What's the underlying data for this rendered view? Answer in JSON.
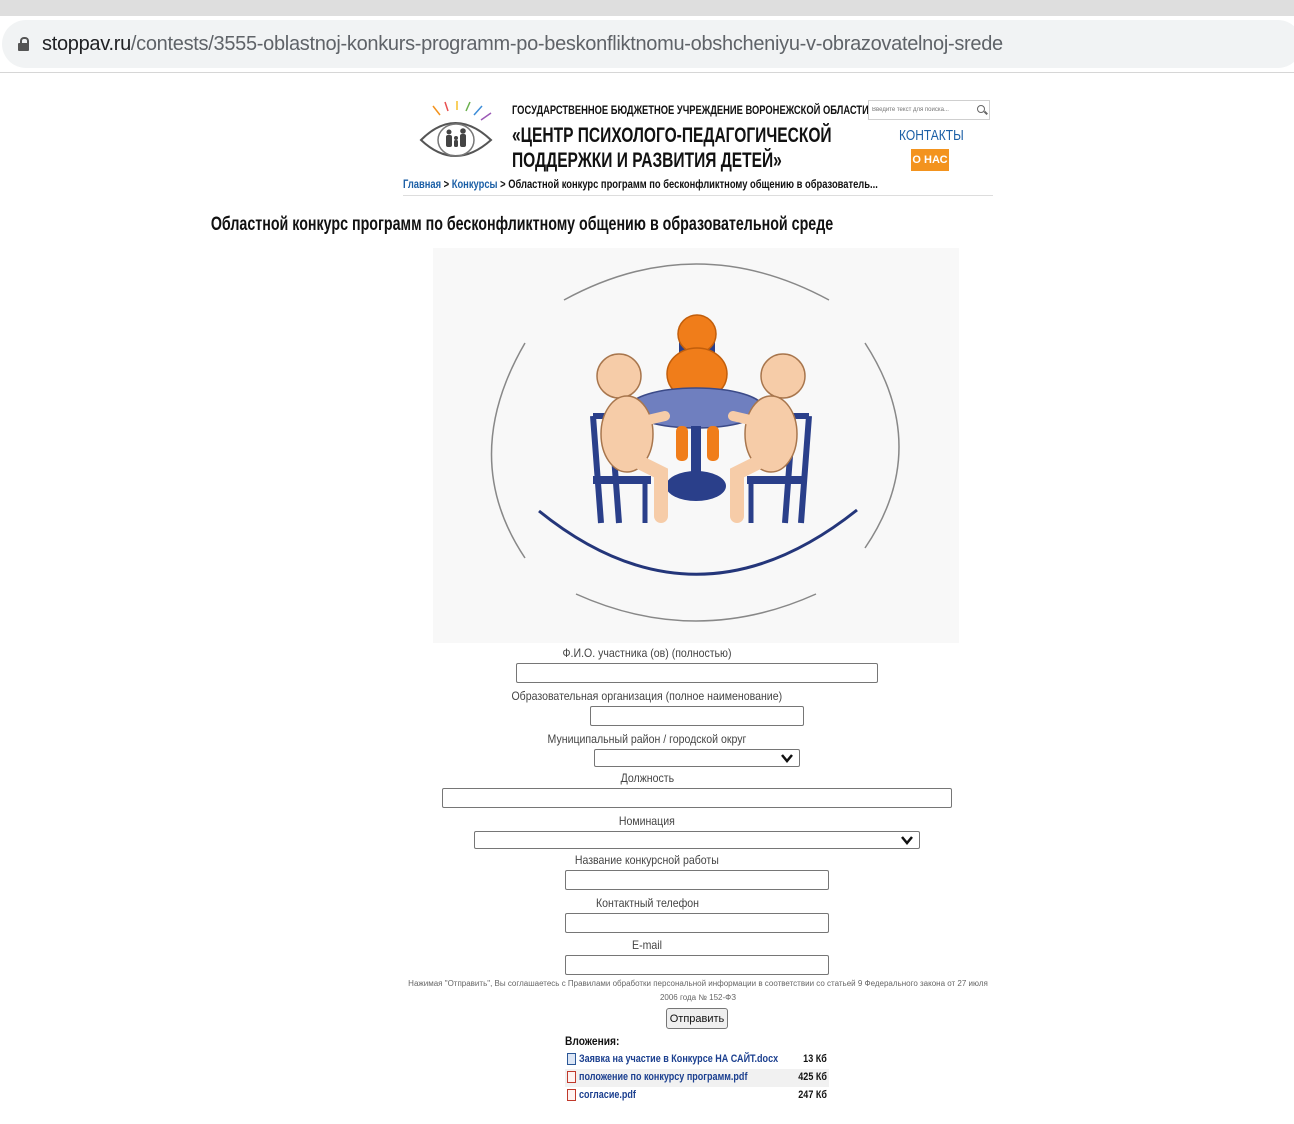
{
  "browser": {
    "url_host": "stoppav.ru",
    "url_path": "/contests/3555-oblastnoj-konkurs-programm-po-beskonfliktnomu-obshcheniyu-v-obrazovatelnoj-srede"
  },
  "header": {
    "org_line1": "ГОСУДАРСТВЕННОЕ БЮДЖЕТНОЕ УЧРЕЖДЕНИЕ ВОРОНЕЖСКОЙ ОБЛАСТИ",
    "org_line2": "«ЦЕНТР ПСИХОЛОГО-ПЕДАГОГИЧЕСКОЙ",
    "org_line3": "ПОДДЕРЖКИ И РАЗВИТИЯ ДЕТЕЙ»",
    "search_placeholder": "Введите текст для поиска...",
    "contacts_label": "КОНТАКТЫ",
    "about_label": "О НАС"
  },
  "breadcrumb": {
    "home": "Главная",
    "sep1": " > ",
    "contests": "Конкурсы",
    "sep2": " > ",
    "current": "Областной конкурс программ по бесконфликтному общению в образователь..."
  },
  "page": {
    "title": "Областной конкурс программ по бесконфликтному общению в образовательной среде"
  },
  "form": {
    "fio_label": "Ф.И.О. участника (ов) (полностью)",
    "org_label": "Образовательная организация (полное наименование)",
    "district_label": "Муниципальный район / городской округ",
    "position_label": "Должность",
    "nomination_label": "Номинация",
    "work_title_label": "Название конкурсной работы",
    "phone_label": "Контактный телефон",
    "email_label": "E-mail",
    "consent_text": "Нажимая \"Отправить\", Вы соглашаетесь с Правилами обработки персональной информации в соответствии со статьей 9 Федерального закона от 27 июля 2006 года № 152-ФЗ",
    "submit_label": "Отправить"
  },
  "attachments": {
    "title": "Вложения:",
    "files": [
      {
        "name": "Заявка на участие в Конкурсе НА САЙТ.docx",
        "size": "13 Кб",
        "icon": "docx-icon"
      },
      {
        "name": "положение по конкурсу программ.pdf",
        "size": "425 Кб",
        "icon": "pdf-icon"
      },
      {
        "name": "согласие.pdf",
        "size": "247 Кб",
        "icon": "pdf-icon"
      }
    ]
  },
  "colors": {
    "link": "#1b5fa6",
    "accent_orange": "#f3931e",
    "figure_orange": "#f07d1a",
    "figure_skin": "#f6cca8",
    "table_blue": "#6f7fbf",
    "chair_navy": "#2a3f8a"
  }
}
